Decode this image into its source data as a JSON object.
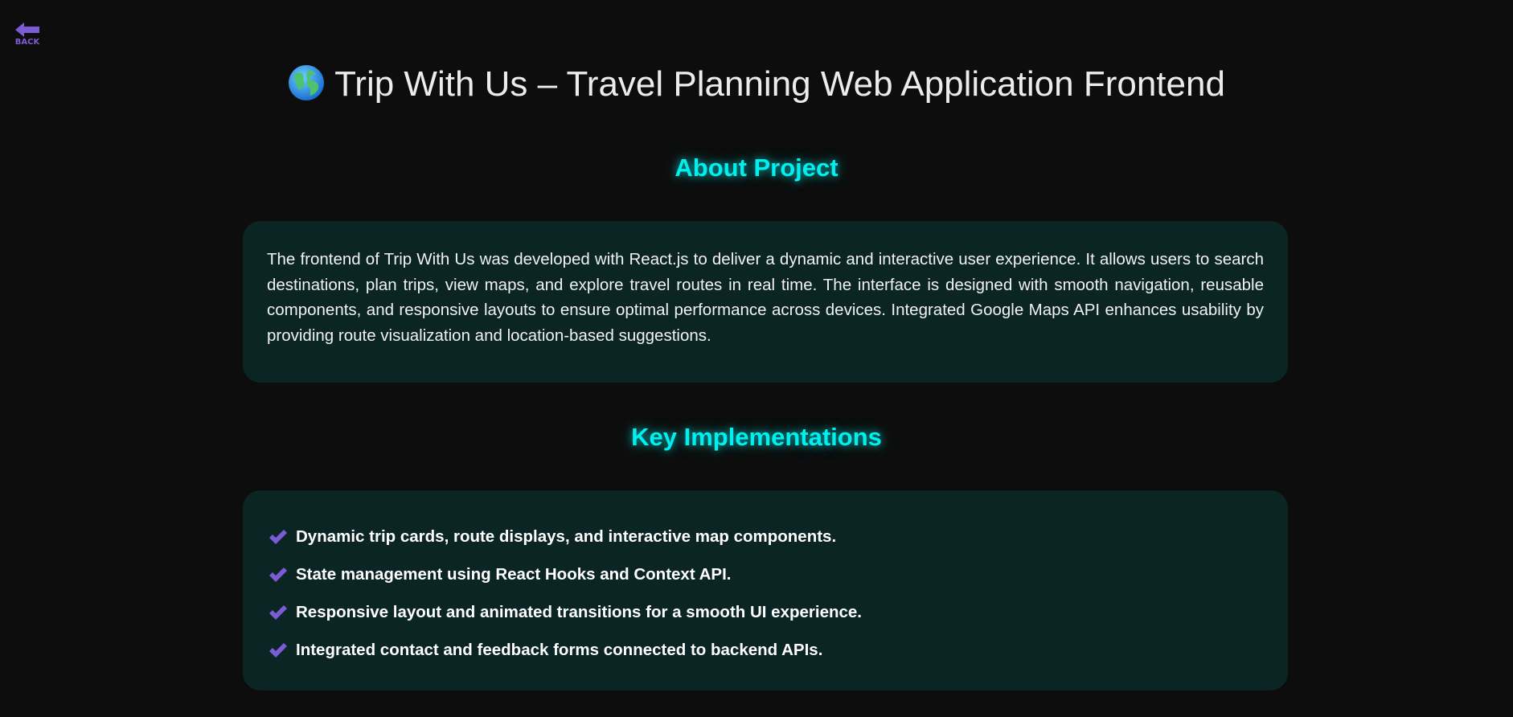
{
  "back": {
    "label": "BACK",
    "icon": "arrow-left-icon"
  },
  "title": {
    "icon": "globe-icon",
    "text": "Trip With Us – Travel Planning Web Application Frontend"
  },
  "about": {
    "heading": "About Project",
    "body": "The frontend of Trip With Us was developed with React.js to deliver a dynamic and interactive user experience. It allows users to search destinations, plan trips, view maps, and explore travel routes in real time. The interface is designed with smooth navigation, reusable components, and responsive layouts to ensure optimal performance across devices. Integrated Google Maps API enhances usability by providing route visualization and location-based suggestions."
  },
  "key_implementations": {
    "heading": "Key Implementations",
    "items": [
      "Dynamic trip cards, route displays, and interactive map components.",
      "State management using React Hooks and Context API.",
      "Responsive layout and animated transitions for a smooth UI experience.",
      "Integrated contact and feedback forms connected to backend APIs."
    ]
  },
  "colors": {
    "background": "#0d0d0d",
    "card": "#0b2424",
    "accent_cyan": "#00f0f0",
    "accent_purple": "#7b5cd6",
    "text": "#f2f2f2"
  }
}
